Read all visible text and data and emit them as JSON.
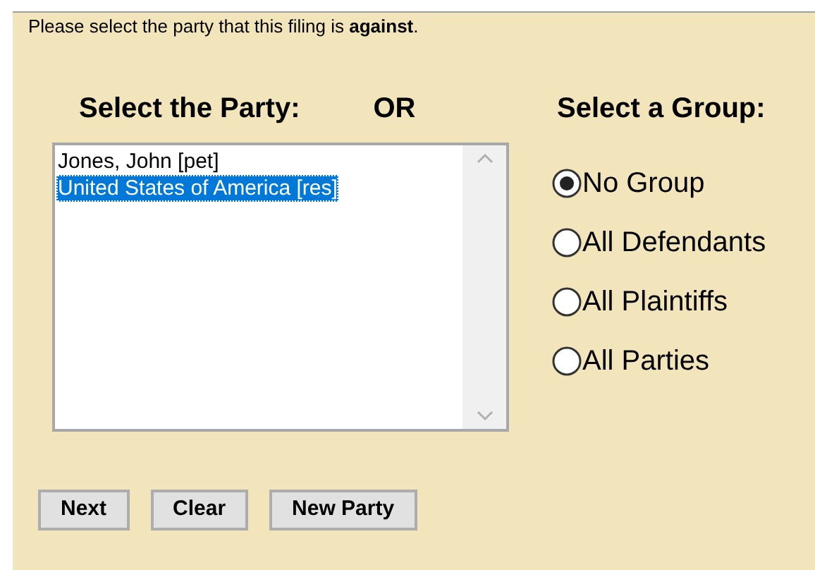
{
  "instruction": "Please select the party that this filing is **against**.",
  "party_heading": "Select the Party:",
  "or_label": "OR",
  "group_heading": "Select a Group:",
  "parties": [
    {
      "label": "Jones, John [pet]",
      "selected": false
    },
    {
      "label": "United States of America [res]",
      "selected": true
    }
  ],
  "groups": [
    {
      "label": "No Group",
      "selected": true
    },
    {
      "label": "All Defendants",
      "selected": false
    },
    {
      "label": "All Plaintiffs",
      "selected": false
    },
    {
      "label": "All Parties",
      "selected": false
    }
  ],
  "buttons": [
    "Next",
    "Clear",
    "New Party"
  ]
}
